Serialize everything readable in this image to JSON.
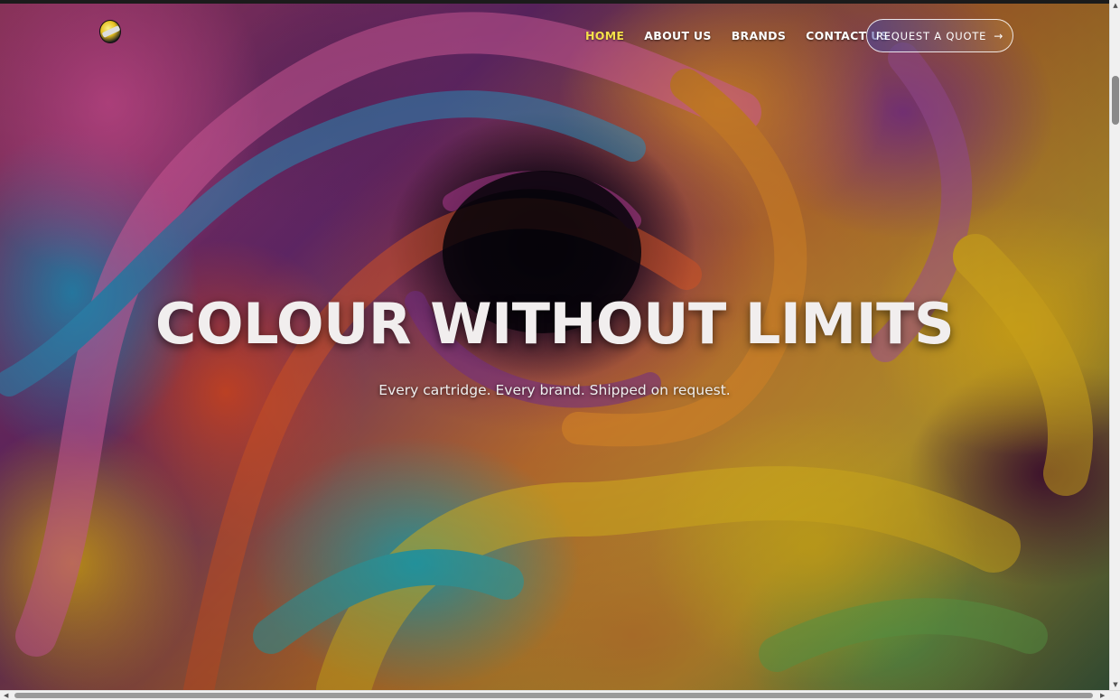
{
  "header": {
    "nav": [
      {
        "label": "HOME",
        "active": true
      },
      {
        "label": "ABOUT US",
        "active": false
      },
      {
        "label": "BRANDS",
        "active": false
      },
      {
        "label": "CONTACT US",
        "active": false
      }
    ],
    "cta_label": "REQUEST A QUOTE",
    "cta_icon": "arrow-right-icon",
    "logo_icon": "brand-logo-icon"
  },
  "hero": {
    "title": "COLOUR WITHOUT LIMITS",
    "subtitle": "Every cartridge. Every brand. Shipped on request."
  },
  "colors": {
    "nav_active": "#f5e04a",
    "nav_default": "#ffffff",
    "title": "#f1eeee"
  }
}
